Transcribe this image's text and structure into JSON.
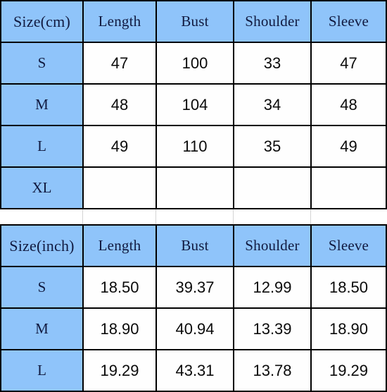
{
  "tables": [
    {
      "id": "cm-table",
      "unit": "cm",
      "headers": [
        "Size(cm)",
        "Length",
        "Bust",
        "Shoulder",
        "Sleeve"
      ],
      "rows": [
        {
          "size": "S",
          "length": "47",
          "bust": "100",
          "shoulder": "33",
          "sleeve": "47"
        },
        {
          "size": "M",
          "length": "48",
          "bust": "104",
          "shoulder": "34",
          "sleeve": "48"
        },
        {
          "size": "L",
          "length": "49",
          "bust": "110",
          "shoulder": "35",
          "sleeve": "49"
        },
        {
          "size": "XL",
          "length": "",
          "bust": "",
          "shoulder": "",
          "sleeve": ""
        }
      ]
    },
    {
      "id": "inch-table",
      "unit": "inch",
      "headers": [
        "Size(inch)",
        "Length",
        "Bust",
        "Shoulder",
        "Sleeve"
      ],
      "rows": [
        {
          "size": "S",
          "length": "18.50",
          "bust": "39.37",
          "shoulder": "12.99",
          "sleeve": "18.50"
        },
        {
          "size": "M",
          "length": "18.90",
          "bust": "40.94",
          "shoulder": "13.39",
          "sleeve": "18.90"
        },
        {
          "size": "L",
          "length": "19.29",
          "bust": "43.31",
          "shoulder": "13.78",
          "sleeve": "19.29"
        }
      ]
    }
  ],
  "colors": {
    "cell_blue": "#8fc4fa",
    "cell_white": "#fefefe",
    "grid_line": "#000000",
    "header_text": "#111a40",
    "data_text": "#0a0a0a"
  }
}
